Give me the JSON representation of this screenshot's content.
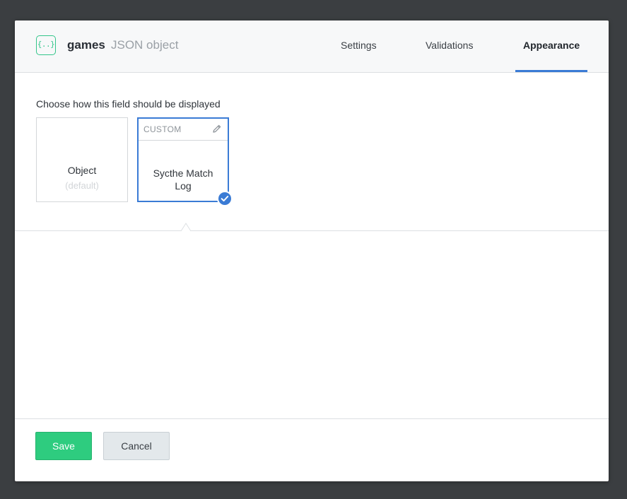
{
  "header": {
    "icon": "json-object-icon",
    "icon_glyph": "{..}",
    "field_name": "games",
    "field_type": "JSON object",
    "tabs": [
      {
        "label": "Settings",
        "active": false
      },
      {
        "label": "Validations",
        "active": false
      },
      {
        "label": "Appearance",
        "active": true
      }
    ]
  },
  "appearance": {
    "prompt": "Choose how this field should be displayed",
    "options": [
      {
        "title": "Object",
        "subtitle": "(default)",
        "selected": false
      },
      {
        "tag": "CUSTOM",
        "title": "Sycthe Match Log",
        "selected": true
      }
    ]
  },
  "footer": {
    "save_label": "Save",
    "cancel_label": "Cancel"
  },
  "colors": {
    "accent": "#3a7bd5",
    "save": "#2ecc7f",
    "icon": "#33c58a"
  }
}
